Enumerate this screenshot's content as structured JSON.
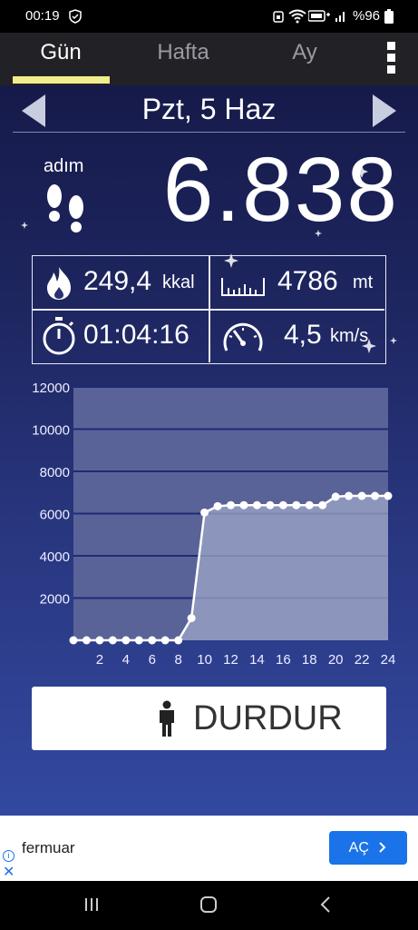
{
  "status_bar": {
    "time": "00:19",
    "battery_text": "%96",
    "icons": [
      "shield-icon",
      "alarm-icon",
      "wifi-icon",
      "signal-icon",
      "battery-icon"
    ]
  },
  "tabs": [
    {
      "label": "Gün",
      "active": true
    },
    {
      "label": "Hafta",
      "active": false
    },
    {
      "label": "Ay",
      "active": false
    }
  ],
  "date": {
    "label": "Pzt, 5 Haz"
  },
  "steps": {
    "label": "adım",
    "count": "6.838"
  },
  "stats": {
    "calories": {
      "value": "249,4",
      "unit": "kkal",
      "icon": "fire-icon"
    },
    "distance": {
      "value": "4786",
      "unit": "mt",
      "icon": "ruler-icon"
    },
    "duration": {
      "value": "01:04:16",
      "icon": "stopwatch-icon"
    },
    "speed": {
      "value": "4,5",
      "unit": "km/s",
      "icon": "speedometer-icon"
    }
  },
  "chart_data": {
    "type": "area",
    "x": [
      0,
      1,
      2,
      3,
      4,
      5,
      6,
      7,
      8,
      9,
      10,
      11,
      12,
      13,
      14,
      15,
      16,
      17,
      18,
      19,
      20,
      21,
      22,
      23,
      24
    ],
    "values": [
      0,
      0,
      0,
      0,
      0,
      0,
      0,
      0,
      0,
      1050,
      6050,
      6350,
      6400,
      6400,
      6400,
      6400,
      6400,
      6400,
      6400,
      6400,
      6800,
      6838,
      6838,
      6838,
      6838
    ],
    "xtick_labels": [
      "2",
      "4",
      "6",
      "8",
      "10",
      "12",
      "14",
      "16",
      "18",
      "20",
      "22",
      "24"
    ],
    "ytick_labels": [
      "2000",
      "4000",
      "6000",
      "8000",
      "10000",
      "12000"
    ],
    "xlim": [
      0,
      24
    ],
    "ylim": [
      0,
      12000
    ],
    "grid": true,
    "title": "",
    "xlabel": "",
    "ylabel": ""
  },
  "stop_button": {
    "label": "DURDUR"
  },
  "ad": {
    "text": "fermuar",
    "button_label": "AÇ",
    "info_label": "i",
    "close_label": "✕"
  },
  "nav": [
    "recent-apps-icon",
    "home-icon",
    "back-icon"
  ],
  "colors": {
    "tab_underline": "#f2ec8c",
    "ad_button": "#1a73e8"
  }
}
